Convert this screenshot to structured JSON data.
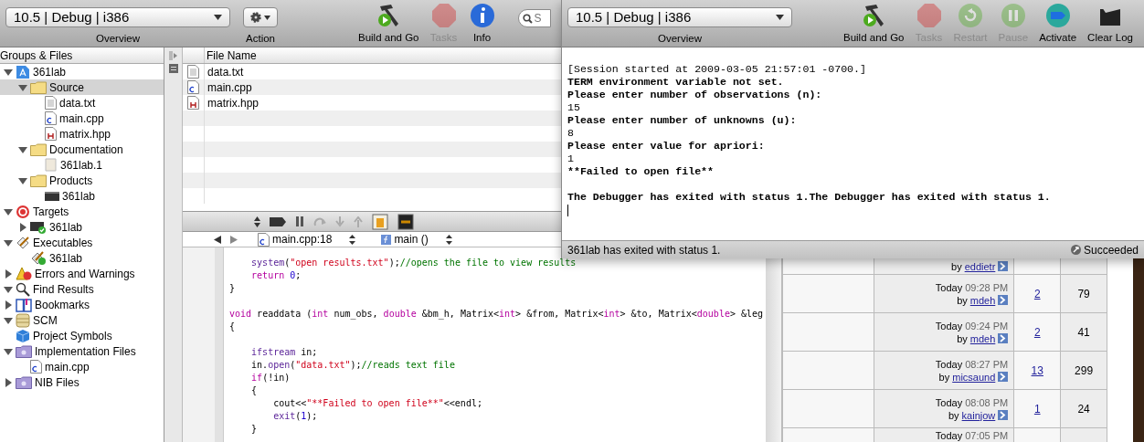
{
  "project_window": {
    "toolbar": {
      "scheme": "10.5 | Debug | i386",
      "scheme_label": "Overview",
      "action_label": "Action",
      "search": {
        "placeholder": "S"
      },
      "items": [
        {
          "kind": "build",
          "label": "Build and Go",
          "disabled": false
        },
        {
          "kind": "stop",
          "label": "Tasks",
          "disabled": true
        },
        {
          "kind": "info",
          "label": "Info",
          "disabled": false
        }
      ]
    },
    "groups_header": "Groups & Files",
    "tree": [
      {
        "label": "361lab",
        "kind": "project",
        "expanded": true,
        "selected": false,
        "children": [
          {
            "label": "Source",
            "kind": "folder",
            "expanded": true,
            "selected": true,
            "children": [
              {
                "label": "data.txt",
                "kind": "text",
                "selected": false
              },
              {
                "label": "main.cpp",
                "kind": "cpp",
                "selected": false
              },
              {
                "label": "matrix.hpp",
                "kind": "header",
                "selected": false
              }
            ]
          },
          {
            "label": "Documentation",
            "kind": "folder",
            "expanded": true,
            "selected": false,
            "children": [
              {
                "label": "361lab.1",
                "kind": "doc",
                "selected": false
              }
            ]
          },
          {
            "label": "Products",
            "kind": "folder",
            "expanded": true,
            "selected": false,
            "children": [
              {
                "label": "361lab",
                "kind": "app",
                "selected": false
              }
            ]
          }
        ]
      },
      {
        "label": "Targets",
        "kind": "target",
        "expanded": true,
        "selected": false,
        "children": [
          {
            "label": "361lab",
            "kind": "app-ok",
            "expanded": false,
            "selected": false
          }
        ]
      },
      {
        "label": "Executables",
        "kind": "exec",
        "expanded": true,
        "selected": false,
        "children": [
          {
            "label": "361lab",
            "kind": "exec-ok",
            "selected": false
          }
        ]
      },
      {
        "label": "Errors and Warnings",
        "kind": "warning",
        "expanded": false,
        "selected": false
      },
      {
        "label": "Find Results",
        "kind": "search",
        "expanded": true,
        "selected": false
      },
      {
        "label": "Bookmarks",
        "kind": "book",
        "expanded": false,
        "selected": false
      },
      {
        "label": "SCM",
        "kind": "scm",
        "expanded": true,
        "selected": false
      },
      {
        "label": "Project Symbols",
        "kind": "cube",
        "selected": false
      },
      {
        "label": "Implementation Files",
        "kind": "smart",
        "expanded": true,
        "selected": false,
        "children": [
          {
            "label": "main.cpp",
            "kind": "cpp",
            "selected": false
          }
        ]
      },
      {
        "label": "NIB Files",
        "kind": "smart",
        "expanded": false,
        "selected": false
      }
    ],
    "file_list": {
      "header": "File Name",
      "files": [
        {
          "name": "data.txt",
          "kind": "text"
        },
        {
          "name": "main.cpp",
          "kind": "cpp"
        },
        {
          "name": "matrix.hpp",
          "kind": "header"
        }
      ]
    },
    "editor": {
      "file": "main.cpp:18",
      "function": "main ()",
      "lines": [
        {
          "tokens": [
            {
              "kind": "function",
              "text": "    system"
            },
            {
              "kind": "plain",
              "text": "("
            },
            {
              "kind": "string",
              "text": "\"open results.txt\""
            },
            {
              "kind": "plain",
              "text": ");"
            },
            {
              "kind": "comment",
              "text": "//opens the file to view results"
            }
          ]
        },
        {
          "tokens": [
            {
              "kind": "keyword",
              "text": "    return "
            },
            {
              "kind": "number",
              "text": "0"
            },
            {
              "kind": "plain",
              "text": ";"
            }
          ]
        },
        {
          "tokens": [
            {
              "kind": "plain",
              "text": "}"
            }
          ]
        },
        {
          "kind": "blank"
        },
        {
          "tokens": [
            {
              "kind": "keyword",
              "text": "void"
            },
            {
              "kind": "plain",
              "text": " readdata ("
            },
            {
              "kind": "keyword",
              "text": "int"
            },
            {
              "kind": "plain",
              "text": " num_obs, "
            },
            {
              "kind": "keyword",
              "text": "double"
            },
            {
              "kind": "plain",
              "text": " &bm_h, Matrix<"
            },
            {
              "kind": "keyword",
              "text": "int"
            },
            {
              "kind": "plain",
              "text": "> &from, Matrix<"
            },
            {
              "kind": "keyword",
              "text": "int"
            },
            {
              "kind": "plain",
              "text": "> &to, Matrix<"
            },
            {
              "kind": "keyword",
              "text": "double"
            },
            {
              "kind": "plain",
              "text": "> &leg"
            }
          ]
        },
        {
          "tokens": [
            {
              "kind": "plain",
              "text": "{"
            }
          ]
        },
        {
          "kind": "blank"
        },
        {
          "tokens": [
            {
              "kind": "function",
              "text": "    ifstream"
            },
            {
              "kind": "plain",
              "text": " in;"
            }
          ]
        },
        {
          "tokens": [
            {
              "kind": "plain",
              "text": "    in."
            },
            {
              "kind": "function",
              "text": "open"
            },
            {
              "kind": "plain",
              "text": "("
            },
            {
              "kind": "string",
              "text": "\"data.txt\""
            },
            {
              "kind": "plain",
              "text": ");"
            },
            {
              "kind": "comment",
              "text": "//reads text file"
            }
          ]
        },
        {
          "tokens": [
            {
              "kind": "keyword",
              "text": "    if"
            },
            {
              "kind": "plain",
              "text": "(!in)"
            }
          ]
        },
        {
          "tokens": [
            {
              "kind": "plain",
              "text": "    {"
            }
          ]
        },
        {
          "tokens": [
            {
              "kind": "plain",
              "text": "        cout<<"
            },
            {
              "kind": "string",
              "text": "\"**Failed to open file**\""
            },
            {
              "kind": "plain",
              "text": "<<endl;"
            }
          ]
        },
        {
          "tokens": [
            {
              "kind": "function",
              "text": "        exit"
            },
            {
              "kind": "plain",
              "text": "("
            },
            {
              "kind": "number",
              "text": "1"
            },
            {
              "kind": "plain",
              "text": ");"
            }
          ]
        },
        {
          "tokens": [
            {
              "kind": "plain",
              "text": "    }"
            }
          ]
        }
      ]
    }
  },
  "forum_table": {
    "rows": [
      {
        "by": "by",
        "user": "eddietr"
      },
      {
        "date": "Today",
        "time": "09:28 PM",
        "by": "by",
        "user": "mdeh",
        "replies": "2",
        "views": "79"
      },
      {
        "date": "Today",
        "time": "09:24 PM",
        "by": "by",
        "user": "mdeh",
        "replies": "2",
        "views": "41"
      },
      {
        "date": "Today",
        "time": "08:27 PM",
        "by": "by",
        "user": "micsaund",
        "replies": "13",
        "views": "299"
      },
      {
        "date": "Today",
        "time": "08:08 PM",
        "by": "by",
        "user": "kainjow",
        "replies": "1",
        "views": "24"
      },
      {
        "date": "Today",
        "time": "07:05 PM"
      }
    ]
  },
  "console_window": {
    "toolbar": {
      "scheme": "10.5 | Debug | i386",
      "scheme_label": "Overview",
      "items": [
        {
          "kind": "build",
          "label": "Build and Go",
          "disabled": false
        },
        {
          "kind": "stop",
          "label": "Tasks",
          "disabled": true
        },
        {
          "kind": "restart",
          "label": "Restart",
          "disabled": true
        },
        {
          "kind": "pause",
          "label": "Pause",
          "disabled": true
        },
        {
          "kind": "activate",
          "label": "Activate",
          "disabled": false
        },
        {
          "kind": "clear",
          "label": "Clear Log",
          "disabled": false
        }
      ]
    },
    "lines": [
      {
        "text": "[Session started at 2009-03-05 21:57:01 -0700.]",
        "bold": false
      },
      {
        "text": "TERM environment variable not set.",
        "bold": true
      },
      {
        "text": "Please enter number of observations (n):",
        "bold": true
      },
      {
        "text": "15",
        "bold": false
      },
      {
        "text": "Please enter number of unknowns (u):",
        "bold": true
      },
      {
        "text": "8",
        "bold": false
      },
      {
        "text": "Please enter value for apriori:",
        "bold": true
      },
      {
        "text": "1",
        "bold": false
      },
      {
        "text": "**Failed to open file**",
        "bold": true
      },
      {
        "kind": "blank"
      },
      {
        "text": "The Debugger has exited with status 1.The Debugger has exited with status 1.",
        "bold": true
      }
    ],
    "status": "361lab has exited with status 1.",
    "result": "Succeeded"
  }
}
